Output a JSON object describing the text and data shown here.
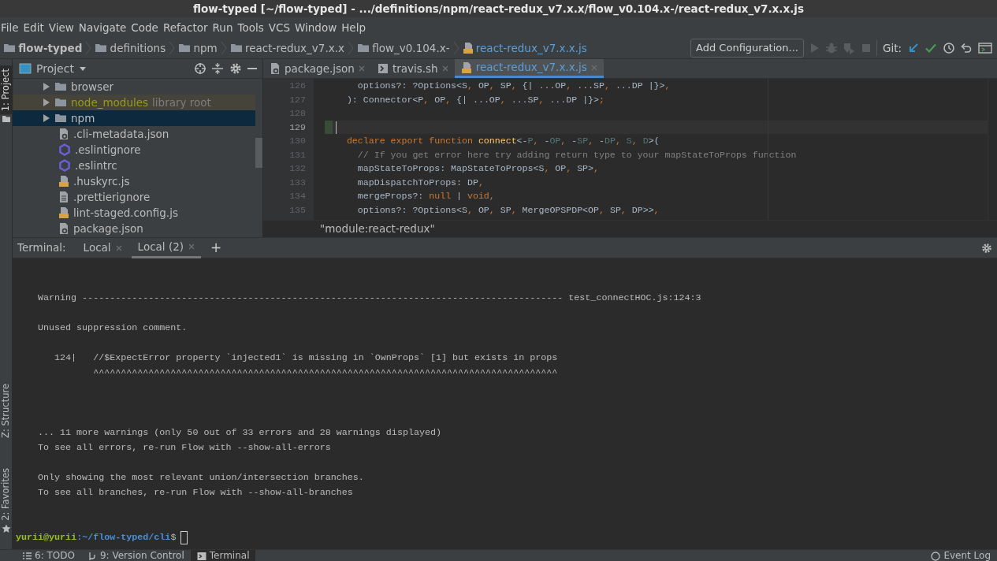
{
  "window": {
    "title": "flow-typed [~/flow-typed] - .../definitions/npm/react-redux_v7.x.x/flow_v0.104.x-/react-redux_v7.x.x.js"
  },
  "menu": [
    "File",
    "Edit",
    "View",
    "Navigate",
    "Code",
    "Refactor",
    "Run",
    "Tools",
    "VCS",
    "Window",
    "Help"
  ],
  "breadcrumbs": [
    {
      "label": "flow-typed",
      "kind": "root"
    },
    {
      "label": "definitions",
      "kind": "folder"
    },
    {
      "label": "npm",
      "kind": "folder"
    },
    {
      "label": "react-redux_v7.x.x",
      "kind": "folder"
    },
    {
      "label": "flow_v0.104.x-",
      "kind": "folder"
    },
    {
      "label": "react-redux_v7.x.x.js",
      "kind": "js"
    }
  ],
  "toolbar": {
    "config_button": "Add Configuration...",
    "git_label": "Git:"
  },
  "tool_strip": [
    {
      "label": "1: Project",
      "selected": true
    },
    {
      "label": "Z: Structure",
      "selected": false
    },
    {
      "label": "2: Favorites",
      "selected": false
    }
  ],
  "project": {
    "title": "Project",
    "items": [
      {
        "label": "browser",
        "kind": "folder",
        "selected": false
      },
      {
        "label": "node_modules",
        "kind": "library-folder",
        "note": "library root",
        "selected": false
      },
      {
        "label": "npm",
        "kind": "folder",
        "selected": true
      },
      {
        "label": ".cli-metadata.json",
        "kind": "json",
        "selected": false
      },
      {
        "label": ".eslintignore",
        "kind": "eslint",
        "selected": false
      },
      {
        "label": ".eslintrc",
        "kind": "eslint",
        "selected": false
      },
      {
        "label": ".huskyrc.js",
        "kind": "js",
        "selected": false
      },
      {
        "label": ".prettierignore",
        "kind": "text",
        "selected": false
      },
      {
        "label": "lint-staged.config.js",
        "kind": "js",
        "selected": false
      },
      {
        "label": "package.json",
        "kind": "json",
        "selected": false
      }
    ]
  },
  "editor": {
    "tabs": [
      {
        "label": "package.json",
        "kind": "json",
        "selected": false
      },
      {
        "label": "travis.sh",
        "kind": "shell",
        "selected": false
      },
      {
        "label": "react-redux_v7.x.x.js",
        "kind": "js",
        "selected": true
      }
    ],
    "lines": [
      {
        "number": "126",
        "current": false,
        "tokens": [
          {
            "text": "    options?: ?Options<S",
            "kind": "plain"
          },
          {
            "text": ", ",
            "kind": "keyword"
          },
          {
            "text": "OP",
            "kind": "plain"
          },
          {
            "text": ", ",
            "kind": "keyword"
          },
          {
            "text": "SP",
            "kind": "plain"
          },
          {
            "text": ", ",
            "kind": "keyword"
          },
          {
            "text": "{| ...OP",
            "kind": "plain"
          },
          {
            "text": ", ",
            "kind": "keyword"
          },
          {
            "text": "...SP",
            "kind": "plain"
          },
          {
            "text": ", ",
            "kind": "keyword"
          },
          {
            "text": "...DP |}>",
            "kind": "plain"
          },
          {
            "text": ",",
            "kind": "keyword"
          }
        ]
      },
      {
        "number": "127",
        "current": false,
        "tokens": [
          {
            "text": "  ): Connector<P",
            "kind": "plain"
          },
          {
            "text": ", ",
            "kind": "keyword"
          },
          {
            "text": "OP",
            "kind": "plain"
          },
          {
            "text": ", ",
            "kind": "keyword"
          },
          {
            "text": "{| ...OP",
            "kind": "plain"
          },
          {
            "text": ", ",
            "kind": "keyword"
          },
          {
            "text": "...SP",
            "kind": "plain"
          },
          {
            "text": ", ",
            "kind": "keyword"
          },
          {
            "text": "...DP |}>",
            "kind": "plain"
          },
          {
            "text": ";",
            "kind": "keyword"
          }
        ]
      },
      {
        "number": "128",
        "current": false
      },
      {
        "number": "129",
        "current": true
      },
      {
        "number": "130",
        "current": false,
        "tokens": [
          {
            "text": "  declare export function ",
            "kind": "keyword"
          },
          {
            "text": "connect",
            "kind": "function"
          },
          {
            "text": "<-",
            "kind": "plain"
          },
          {
            "text": "P",
            "kind": "param"
          },
          {
            "text": ", ",
            "kind": "keyword"
          },
          {
            "text": "-",
            "kind": "plain"
          },
          {
            "text": "OP",
            "kind": "param"
          },
          {
            "text": ", ",
            "kind": "keyword"
          },
          {
            "text": "-",
            "kind": "plain"
          },
          {
            "text": "SP",
            "kind": "param"
          },
          {
            "text": ", ",
            "kind": "keyword"
          },
          {
            "text": "-",
            "kind": "plain"
          },
          {
            "text": "DP",
            "kind": "param"
          },
          {
            "text": ", ",
            "kind": "keyword"
          },
          {
            "text": "S",
            "kind": "param"
          },
          {
            "text": ", ",
            "kind": "keyword"
          },
          {
            "text": "D",
            "kind": "param"
          },
          {
            "text": ">(",
            "kind": "plain"
          }
        ]
      },
      {
        "number": "131",
        "current": false,
        "tokens": [
          {
            "text": "    // If you get error here try adding return type to your mapStateToProps function",
            "kind": "comment"
          }
        ]
      },
      {
        "number": "132",
        "current": false,
        "tokens": [
          {
            "text": "    mapStateToProps: MapStateToProps<S",
            "kind": "plain"
          },
          {
            "text": ", ",
            "kind": "keyword"
          },
          {
            "text": "OP",
            "kind": "plain"
          },
          {
            "text": ", ",
            "kind": "keyword"
          },
          {
            "text": "SP>",
            "kind": "plain"
          },
          {
            "text": ",",
            "kind": "keyword"
          }
        ]
      },
      {
        "number": "133",
        "current": false,
        "tokens": [
          {
            "text": "    mapDispatchToProps: DP",
            "kind": "plain"
          },
          {
            "text": ",",
            "kind": "keyword"
          }
        ]
      },
      {
        "number": "134",
        "current": false,
        "tokens": [
          {
            "text": "    mergeProps?: ",
            "kind": "plain"
          },
          {
            "text": "null",
            "kind": "keyword"
          },
          {
            "text": " | ",
            "kind": "plain"
          },
          {
            "text": "void",
            "kind": "keyword"
          },
          {
            "text": ",",
            "kind": "keyword"
          }
        ]
      },
      {
        "number": "135",
        "current": false,
        "tokens": [
          {
            "text": "    options?: ?Options<S",
            "kind": "plain"
          },
          {
            "text": ", ",
            "kind": "keyword"
          },
          {
            "text": "OP",
            "kind": "plain"
          },
          {
            "text": ", ",
            "kind": "keyword"
          },
          {
            "text": "SP",
            "kind": "plain"
          },
          {
            "text": ", ",
            "kind": "keyword"
          },
          {
            "text": "MergeOPSPDP<OP",
            "kind": "plain"
          },
          {
            "text": ", ",
            "kind": "keyword"
          },
          {
            "text": "SP",
            "kind": "plain"
          },
          {
            "text": ", ",
            "kind": "keyword"
          },
          {
            "text": "DP>>",
            "kind": "plain"
          },
          {
            "text": ",",
            "kind": "keyword"
          }
        ]
      }
    ],
    "breadcrumb": "\"module:react-redux\""
  },
  "terminal": {
    "label": "Terminal:",
    "tabs": [
      {
        "label": "Local",
        "selected": false
      },
      {
        "label": "Local (2)",
        "selected": true
      }
    ],
    "add_tab": "+",
    "blocks": [
      [
        "Warning --------------------------------------------------------------------------------------- test_connectHOC.js:124:3"
      ],
      [
        "Unused suppression comment."
      ],
      [
        "   124|   //$ExpectError property `injected1` is missing in `OwnProps` [1] but exists in props",
        "          ^^^^^^^^^^^^^^^^^^^^^^^^^^^^^^^^^^^^^^^^^^^^^^^^^^^^^^^^^^^^^^^^^^^^^^^^^^^^^^^^^^^^"
      ],
      [
        "... 11 more warnings (only 50 out of 33 errors and 28 warnings displayed)",
        "To see all errors, re-run Flow with --show-all-errors"
      ],
      [
        "Only showing the most relevant union/intersection branches.",
        "To see all branches, re-run Flow with --show-all-branches"
      ]
    ],
    "prompt": {
      "user": "yurii@yurii",
      "path": ":~/flow-typed/cli",
      "symbol": "$"
    }
  },
  "status_bar": [
    {
      "label": "6: TODO",
      "kind": "list",
      "selected": false
    },
    {
      "label": "9: Version Control",
      "kind": "vcs",
      "selected": false
    },
    {
      "label": "Terminal",
      "kind": "terminal",
      "selected": true
    },
    {
      "label": "Event Log",
      "kind": "log",
      "selected": false
    }
  ]
}
